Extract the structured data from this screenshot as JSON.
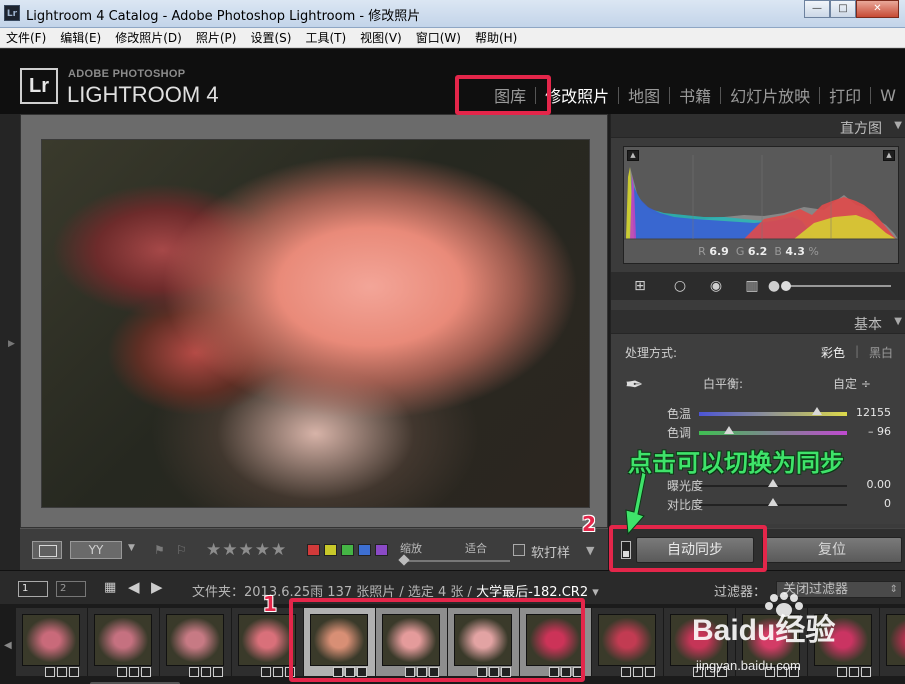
{
  "window": {
    "title": "Lightroom 4 Catalog - Adobe Photoshop Lightroom - 修改照片",
    "icon": "Lr",
    "controls": [
      "minimize",
      "maximize",
      "close"
    ]
  },
  "menu": [
    "文件(F)",
    "编辑(E)",
    "修改照片(D)",
    "照片(P)",
    "设置(S)",
    "工具(T)",
    "视图(V)",
    "窗口(W)",
    "帮助(H)"
  ],
  "identity": {
    "logo": "Lr",
    "brand_line1": "ADOBE PHOTOSHOP",
    "brand_line2": "LIGHTROOM 4"
  },
  "modules": [
    {
      "label": "图库",
      "active": false
    },
    {
      "label": "修改照片",
      "active": true
    },
    {
      "label": "地图",
      "active": false
    },
    {
      "label": "书籍",
      "active": false
    },
    {
      "label": "幻灯片放映",
      "active": false
    },
    {
      "label": "打印",
      "active": false
    },
    {
      "label": "W",
      "active": false
    }
  ],
  "toolbar": {
    "compare_label": "YY",
    "stars": "★★★★★",
    "color_labels": [
      "#d13a3a",
      "#c9c92a",
      "#45b545",
      "#3d6fd1",
      "#8b4ac6"
    ],
    "zoom_label": "缩放",
    "zoom_fit": "适合",
    "softproof_label": "软打样"
  },
  "histogram": {
    "title": "直方图",
    "r_label": "R",
    "r_value": "6.9",
    "g_label": "G",
    "g_value": "6.2",
    "b_label": "B",
    "b_value": "4.3",
    "percent": "%"
  },
  "basic": {
    "title": "基本",
    "treatment_label": "处理方式:",
    "color_option": "彩色",
    "bw_option": "黑白",
    "wb_label": "白平衡:",
    "wb_value": "自定 ÷",
    "temp_label": "色温",
    "temp_value": "12155",
    "temp_position": 0.8,
    "tint_label": "色调",
    "tint_value": "– 96",
    "tint_position": 0.2,
    "exposure_label": "曝光度",
    "exposure_value": "0.00",
    "exposure_position": 0.5,
    "contrast_label": "对比度",
    "contrast_value": "0",
    "contrast_position": 0.5
  },
  "sync": {
    "auto_sync_label": "自动同步",
    "reset_label": "复位"
  },
  "filmstrip_nav": {
    "screen1": "1",
    "screen2": "2",
    "folder_text": "文件夹：2013.6.25雨   137 张照片 / 选定 4 张 / ",
    "current_file": "大学最后-182.CR2",
    "filter_label": "过滤器：",
    "filter_value": "关闭过滤器"
  },
  "filmstrip": {
    "thumbnails": [
      {
        "color": "#c96a7a",
        "selected": false
      },
      {
        "color": "#c57180",
        "selected": false
      },
      {
        "color": "#c77a84",
        "selected": false
      },
      {
        "color": "#d9707a",
        "selected": false
      },
      {
        "color": "#d88f75",
        "selected": true,
        "primary": true
      },
      {
        "color": "#e49b9b",
        "selected": true
      },
      {
        "color": "#e2a3a3",
        "selected": true
      },
      {
        "color": "#cc3358",
        "selected": true
      },
      {
        "color": "#c23b52",
        "selected": false
      },
      {
        "color": "#c53557",
        "selected": false
      },
      {
        "color": "#d33c66",
        "selected": false
      },
      {
        "color": "#ca3462",
        "selected": false
      },
      {
        "color": "#bf2e52",
        "selected": false
      }
    ]
  },
  "annotations": {
    "callout_text": "点击可以切换为同步",
    "step1": "1",
    "step2": "2",
    "watermark_brand": "Baidu经验",
    "watermark_url": "jingyan.baidu.com"
  }
}
